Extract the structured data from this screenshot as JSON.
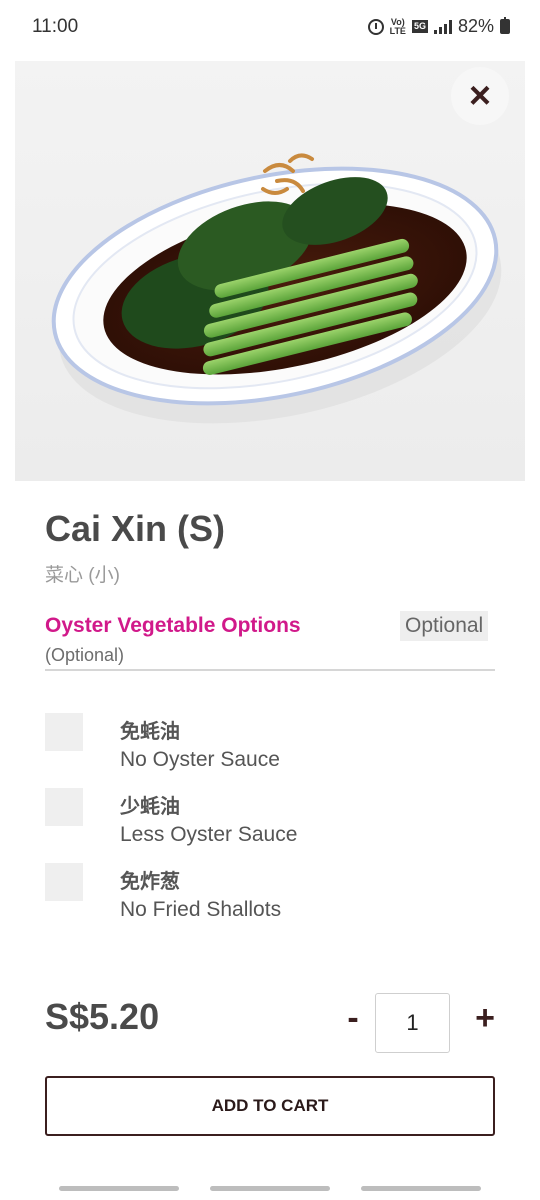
{
  "status_bar": {
    "time": "11:00",
    "network_label_top": "Vo)",
    "network_label_bottom": "LTE",
    "network_5g": "5G",
    "battery_text": "82%"
  },
  "header": {
    "close_icon": "×"
  },
  "item": {
    "title": "Cai Xin (S)",
    "subtitle": "菜心 (小)",
    "price": "S$5.20"
  },
  "options_group": {
    "title": "Oyster Vegetable Options",
    "subtitle": "(Optional)",
    "badge": "Optional",
    "items": [
      {
        "zh": "免蚝油",
        "en": "No Oyster Sauce"
      },
      {
        "zh": "少蚝油",
        "en": "Less Oyster Sauce"
      },
      {
        "zh": "免炸葱",
        "en": "No Fried Shallots"
      }
    ]
  },
  "quantity": {
    "minus": "-",
    "value": "1",
    "plus": "+"
  },
  "actions": {
    "add_to_cart": "ADD TO CART"
  },
  "colors": {
    "accent": "#d1198a",
    "button_border": "#3b1f1f"
  }
}
